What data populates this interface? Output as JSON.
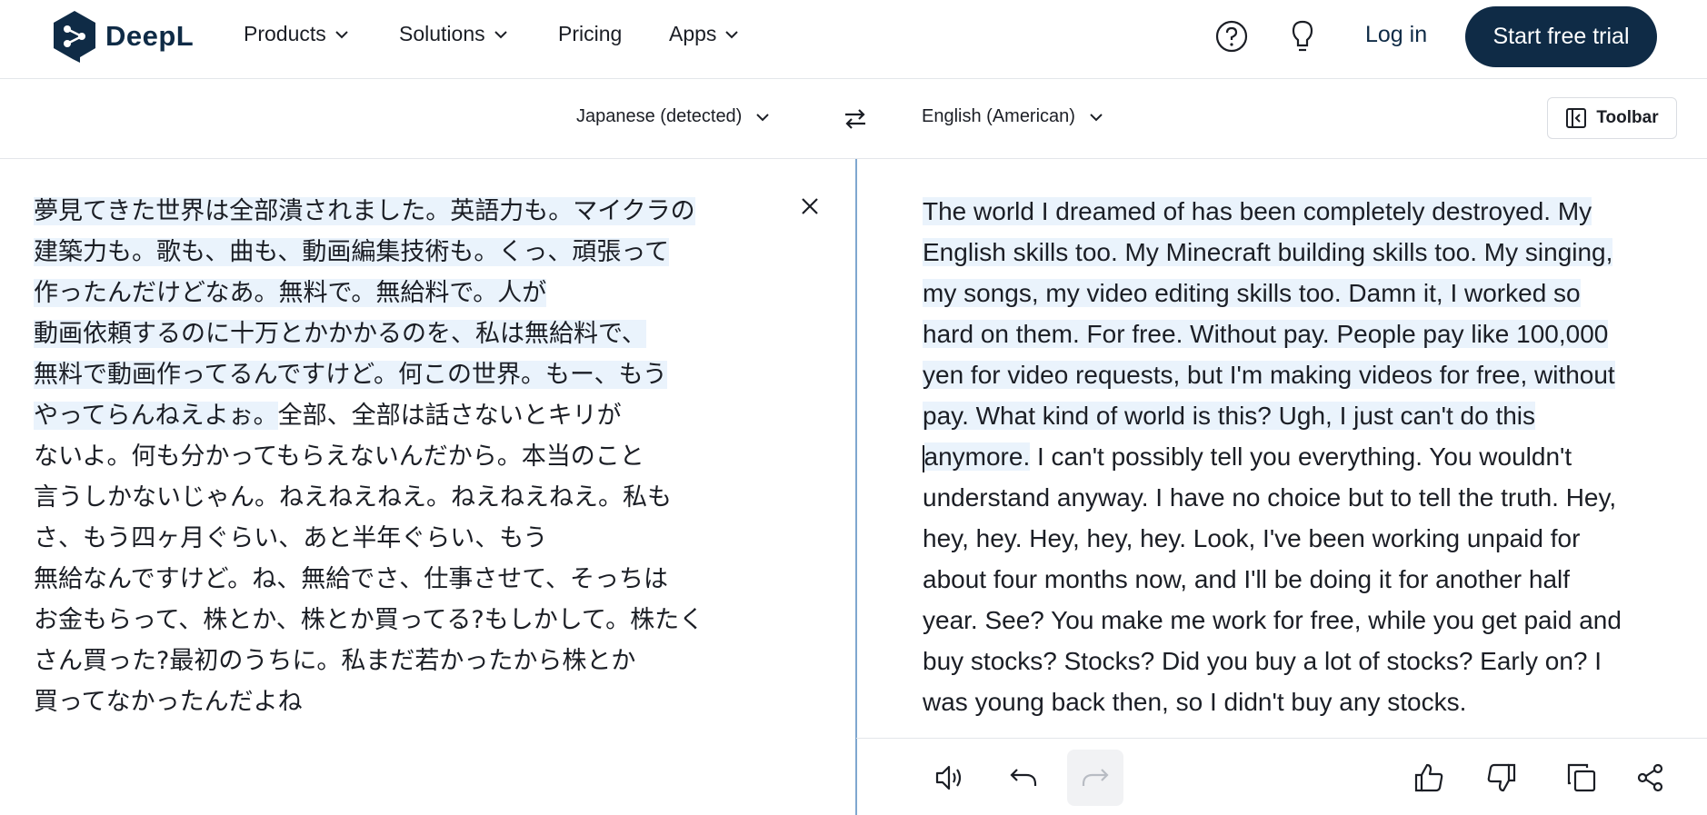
{
  "header": {
    "logo_text": "DeepL",
    "nav": [
      {
        "label": "Products",
        "has_dropdown": true
      },
      {
        "label": "Solutions",
        "has_dropdown": true
      },
      {
        "label": "Pricing",
        "has_dropdown": false
      },
      {
        "label": "Apps",
        "has_dropdown": true
      }
    ],
    "icons": [
      "help-icon",
      "lightbulb-icon"
    ],
    "login_label": "Log in",
    "trial_label": "Start free trial"
  },
  "language_bar": {
    "source_language": "Japanese (detected)",
    "target_language": "English (American)",
    "toolbar_label": "Toolbar"
  },
  "source": {
    "highlighted_lines": [
      "夢見てきた世界は全部潰されました。英語力も。マイクラの",
      "建築力も。歌も、曲も、動画編集技術も。くっ、頑張って",
      "作ったんだけどなあ。無料で。無給料で。人が",
      "動画依頼するのに十万とかかかるのを、私は無給料で、",
      "無料で動画作ってるんですけど。何この世界。もー、もう"
    ],
    "mixed_line": {
      "highlighted": "やってらんねえよぉ。",
      "plain": "全部、全部は話さないとキリが"
    },
    "plain_lines": [
      "ないよ。何も分かってもらえないんだから。本当のこと",
      "言うしかないじゃん。ねえねえねえ。ねえねえねえ。私も",
      "さ、もう四ヶ月ぐらい、あと半年ぐらい、もう",
      "無給なんですけど。ね、無給でさ、仕事させて、そっちは",
      "お金もらって、株とか、株とか買ってる?もしかして。株たく",
      "さん買った?最初のうちに。私まだ若かったから株とか",
      "買ってなかったんだよね"
    ]
  },
  "target": {
    "highlighted_lines": [
      "The world I dreamed of has been completely destroyed. My",
      "English skills too. My Minecraft building skills too. My singing,",
      "my songs, my video editing skills too. Damn it, I worked so",
      "hard on them. For free. Without pay. People pay like 100,000",
      "yen for video requests, but I'm making videos for free, without",
      "pay. What kind of world is this? Ugh, I just can't do this"
    ],
    "mixed_line": {
      "highlighted": "anymore.",
      "plain": " I can't possibly tell you everything. You wouldn't"
    },
    "plain_lines": [
      "understand anyway. I have no choice but to tell the truth. Hey,",
      "hey, hey. Hey, hey, hey. Look, I've been working unpaid for",
      "about four months now, and I'll be doing it for another half",
      "year. See? You make me work for free, while you get paid and",
      "buy stocks? Stocks? Did you buy a lot of stocks? Early on? I",
      "was young back then, so I didn't buy any stocks."
    ]
  },
  "actions": [
    "speaker-icon",
    "undo-icon",
    "redo-icon",
    "thumbs-up-icon",
    "thumbs-down-icon",
    "copy-icon",
    "share-icon"
  ],
  "colors": {
    "brand": "#0f2b46",
    "highlight": "#eaf3fc",
    "divider": "#7fa7cf"
  }
}
